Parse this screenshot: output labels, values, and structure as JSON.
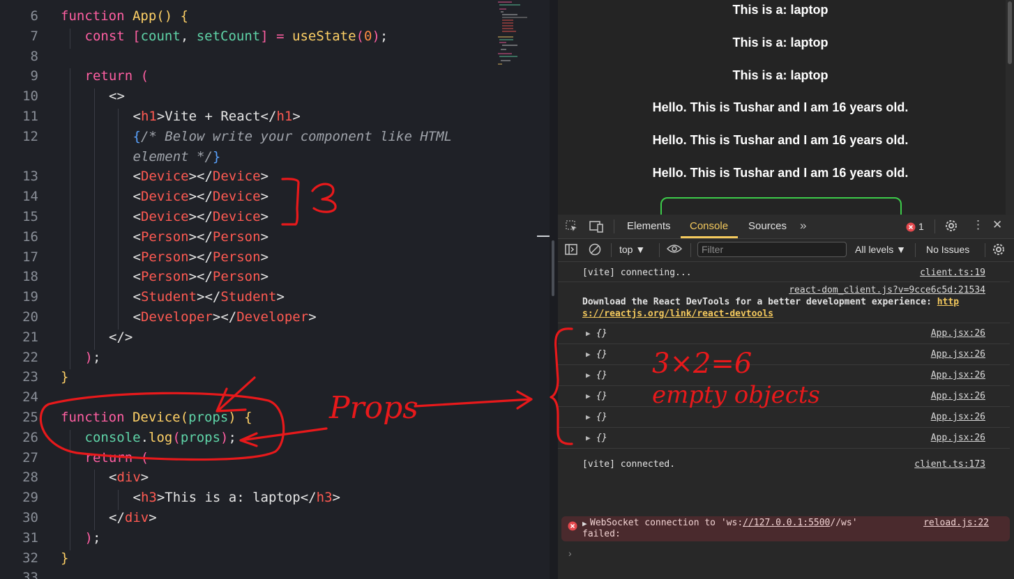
{
  "editor": {
    "lines": [
      {
        "num": "6",
        "indent": 0,
        "html": "<span class='kw'>function</span> <span class='fn'>App</span><span class='fn'>()</span> <span class='fn'>{</span>"
      },
      {
        "num": "7",
        "indent": 1,
        "html": "<span class='kw'>const</span> <span class='kw'>[</span><span class='var'>count</span>, <span class='var'>setCount</span><span class='kw'>]</span> <span class='kw'>=</span> <span class='fn'>useState</span><span class='kw'>(</span><span class='num'>0</span><span class='kw'>)</span>;"
      },
      {
        "num": "8",
        "indent": 0,
        "html": ""
      },
      {
        "num": "9",
        "indent": 1,
        "html": "<span class='kw'>return</span> <span class='kw'>(</span>"
      },
      {
        "num": "10",
        "indent": 2,
        "html": "&lt;&gt;"
      },
      {
        "num": "11",
        "indent": 3,
        "html": "&lt;<span class='tag'>h1</span>&gt;Vite + React&lt;/<span class='tag'>h1</span>&gt;"
      },
      {
        "num": "12",
        "indent": 3,
        "html": "<span class='brk'>{</span><span class='cm'>/* Below write your component like HTML</span>"
      },
      {
        "num": "",
        "indent": 3,
        "html": "<span class='cm'>element */</span><span class='brk'>}</span>"
      },
      {
        "num": "13",
        "indent": 3,
        "html": "&lt;<span class='tag'>Device</span>&gt;&lt;/<span class='tag'>Device</span>&gt;"
      },
      {
        "num": "14",
        "indent": 3,
        "html": "&lt;<span class='tag'>Device</span>&gt;&lt;/<span class='tag'>Device</span>&gt;"
      },
      {
        "num": "15",
        "indent": 3,
        "html": "&lt;<span class='tag'>Device</span>&gt;&lt;/<span class='tag'>Device</span>&gt;"
      },
      {
        "num": "16",
        "indent": 3,
        "html": "&lt;<span class='tag'>Person</span>&gt;&lt;/<span class='tag'>Person</span>&gt;"
      },
      {
        "num": "17",
        "indent": 3,
        "html": "&lt;<span class='tag'>Person</span>&gt;&lt;/<span class='tag'>Person</span>&gt;"
      },
      {
        "num": "18",
        "indent": 3,
        "html": "&lt;<span class='tag'>Person</span>&gt;&lt;/<span class='tag'>Person</span>&gt;"
      },
      {
        "num": "19",
        "indent": 3,
        "html": "&lt;<span class='tag'>Student</span>&gt;&lt;/<span class='tag'>Student</span>&gt;"
      },
      {
        "num": "20",
        "indent": 3,
        "html": "&lt;<span class='tag'>Developer</span>&gt;&lt;/<span class='tag'>Developer</span>&gt;"
      },
      {
        "num": "21",
        "indent": 2,
        "html": "&lt;/&gt;"
      },
      {
        "num": "22",
        "indent": 1,
        "html": "<span class='kw'>)</span>;"
      },
      {
        "num": "23",
        "indent": 0,
        "html": "<span class='fn'>}</span>"
      },
      {
        "num": "24",
        "indent": 0,
        "html": ""
      },
      {
        "num": "25",
        "indent": 0,
        "html": "<span class='kw'>function</span> <span class='fn'>Device</span><span class='fn'>(</span><span class='var'>props</span><span class='fn'>)</span> <span class='fn'>{</span>"
      },
      {
        "num": "26",
        "indent": 1,
        "html": "<span class='var'>console</span>.<span class='fn'>log</span><span class='kw'>(</span><span class='var'>props</span><span class='kw'>)</span>;"
      },
      {
        "num": "27",
        "indent": 1,
        "html": "<span class='kw'>return</span> <span class='kw'>(</span>"
      },
      {
        "num": "28",
        "indent": 2,
        "html": "&lt;<span class='tag'>div</span>&gt;"
      },
      {
        "num": "29",
        "indent": 3,
        "html": "&lt;<span class='tag'>h3</span>&gt;This is a: laptop&lt;/<span class='tag'>h3</span>&gt;"
      },
      {
        "num": "30",
        "indent": 2,
        "html": "&lt;/<span class='tag'>div</span>&gt;"
      },
      {
        "num": "31",
        "indent": 1,
        "html": "<span class='kw'>)</span>;"
      },
      {
        "num": "32",
        "indent": 0,
        "html": "<span class='fn'>}</span>"
      },
      {
        "num": "33",
        "indent": 0,
        "html": ""
      }
    ]
  },
  "preview": {
    "lines": [
      "This is a: laptop",
      "This is a: laptop",
      "This is a: laptop",
      "Hello. This is Tushar and I am 16 years old.",
      "Hello. This is Tushar and I am 16 years old.",
      "Hello. This is Tushar and I am 16 years old."
    ]
  },
  "devtools": {
    "tabs": [
      "Elements",
      "Console",
      "Sources"
    ],
    "active_tab": "Console",
    "error_count": "1",
    "context": "top",
    "filter_placeholder": "Filter",
    "levels": "All levels",
    "issues": "No Issues",
    "console": {
      "vite_connecting": "[vite] connecting...",
      "vite_connecting_src": "client.ts:19",
      "devtools_src": "react-dom_client.js?v=9cce6c5d:21534",
      "devtools_msg": "Download the React DevTools for a better development experience:",
      "devtools_link_1": "http",
      "devtools_link_2": "s://reactjs.org/link/react-devtools",
      "object_label": "{}",
      "object_src": "App.jsx:26",
      "objects_count": 6,
      "vite_connected": "[vite] connected.",
      "vite_connected_src": "client.ts:173",
      "error_prefix": "WebSocket connection to 'ws:",
      "error_url": "//127.0.0.1:5500",
      "error_suffix": "//ws'",
      "error_line2": "failed:",
      "error_src": "reload.js:22"
    }
  },
  "annotations": {
    "three": "3",
    "props": "Props",
    "math": "3×2=6",
    "empty": "empty objects"
  }
}
